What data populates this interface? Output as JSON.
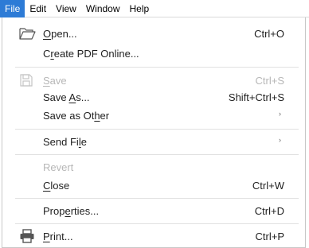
{
  "menubar": {
    "items": [
      {
        "label": "File"
      },
      {
        "label": "Edit"
      },
      {
        "label": "View"
      },
      {
        "label": "Window"
      },
      {
        "label": "Help"
      }
    ]
  },
  "file_menu": {
    "items": {
      "open": {
        "label_u": "O",
        "label_rest": "pen...",
        "shortcut": "Ctrl+O",
        "icon": "folder-open-icon"
      },
      "create_pdf": {
        "label_pre": "C",
        "label_u": "r",
        "label_rest": "eate PDF Online...",
        "raw": "Create PDF Online..."
      },
      "save": {
        "label_u": "S",
        "label_rest": "ave",
        "shortcut": "Ctrl+S",
        "icon": "save-icon",
        "disabled": true
      },
      "save_as": {
        "label_pre": "Save ",
        "label_u": "A",
        "label_rest": "s...",
        "shortcut": "Shift+Ctrl+S"
      },
      "save_other": {
        "label_pre": "Save as Ot",
        "label_u": "h",
        "label_rest": "er",
        "submenu_arrow": "›"
      },
      "send_file": {
        "label_pre": "Send Fi",
        "label_u": "l",
        "label_rest": "e",
        "submenu_arrow": "›"
      },
      "revert": {
        "label": "Revert",
        "disabled": true
      },
      "close": {
        "label_u": "C",
        "label_rest": "lose",
        "shortcut": "Ctrl+W"
      },
      "properties": {
        "label_pre": "Prop",
        "label_u": "e",
        "label_rest": "rties...",
        "shortcut": "Ctrl+D"
      },
      "print": {
        "label_u": "P",
        "label_rest": "rint...",
        "shortcut": "Ctrl+P",
        "icon": "printer-icon"
      }
    }
  },
  "colors": {
    "accent": "#2d7bd6",
    "disabled_text": "#b7b7b7",
    "separator": "#e1e1e1"
  }
}
